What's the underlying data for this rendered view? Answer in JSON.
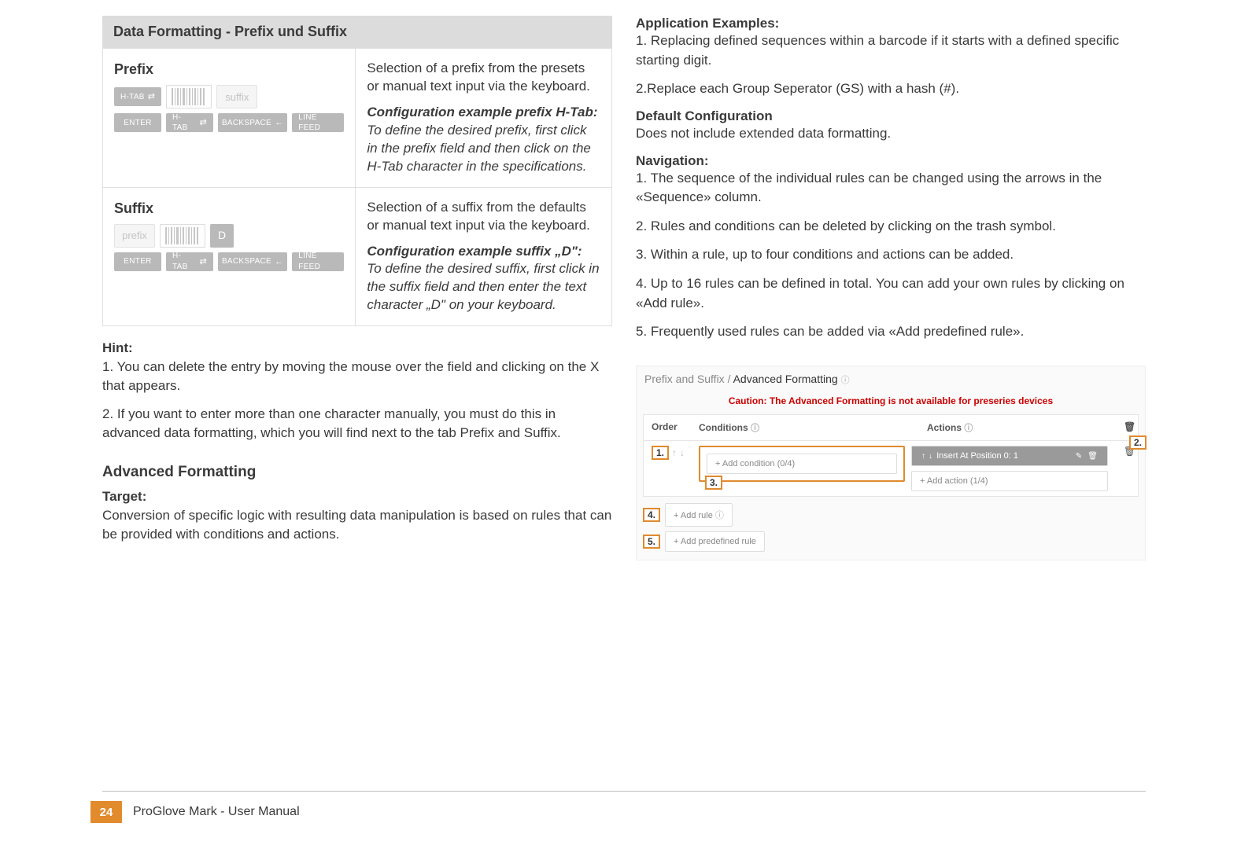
{
  "left": {
    "section_title": "Data Formatting - Prefix und Suffix",
    "prefix": {
      "title": "Prefix",
      "desc": "Selection of a prefix from the presets or manual text input via the keyboard.",
      "ex_h": "Configuration example prefix H-Tab:",
      "ex_b": "To define the desired prefix, first click in the prefix field and then click on the H-Tab character in the specifications.",
      "suffix_ghost": "suffix"
    },
    "suffix": {
      "title": "Suffix",
      "desc": "Selection of a suffix from the defaults or manual text input via the keyboard.",
      "ex_h": "Configuration example suffix „D\":",
      "ex_b": "To define the desired suffix, first click in the suffix field and then enter the text character „D\" on your keyboard.",
      "prefix_ghost": "prefix",
      "d_label": "D"
    },
    "chips": {
      "htab": "H-TAB",
      "enter": "ENTER",
      "backspace": "BACKSPACE",
      "linefeed": "LINE FEED"
    },
    "hint_h": "Hint:",
    "hint_1": "1. You can delete the entry by moving the mouse over the field and clicking on the X that appears.",
    "hint_2": "2. If you want to enter more than one character manually, you must do this in advanced data formatting, which you will find next to the tab Prefix and Suffix.",
    "adv_h": "Advanced Formatting",
    "target_h": "Target:",
    "target_p": "Conversion of specific logic with resulting data manipulation is based on rules that can be provided with conditions and actions."
  },
  "right": {
    "app_h": "Application Examples:",
    "app_1": "1. Replacing defined sequences within a barcode if it starts with a defined specific starting digit.",
    "app_2": "2.Replace each Group Seperator (GS) with a hash (#).",
    "def_h": "Default Configuration",
    "def_p": "Does not include extended data formatting.",
    "nav_h": "Navigation:",
    "nav_1": "1. The sequence of the individual rules can be changed using the arrows in the «Sequence» column.",
    "nav_2": "2. Rules and conditions can be deleted by clicking on the trash symbol.",
    "nav_3": "3. Within a rule, up to four conditions and actions can be added.",
    "nav_4": "4. Up to 16 rules can be defined in total. You can add your own rules by clicking on «Add rule».",
    "nav_5": "5. Frequently used rules can be added via «Add predefined rule»."
  },
  "af": {
    "crumb_prev": "Prefix and Suffix",
    "crumb_sep": "/",
    "crumb_cur": "Advanced Formatting",
    "warn": "Caution: The Advanced Formatting is not available for preseries devices",
    "th_order": "Order",
    "th_cond": "Conditions",
    "th_act": "Actions",
    "order_val": "1.",
    "add_cond": "+ Add condition (0/4)",
    "insert_act": "Insert At Position 0:  1",
    "add_act": "+ Add action (1/4)",
    "add_rule": "+ Add rule",
    "add_pre": "+ Add predefined rule",
    "m1": "1.",
    "m2": "2.",
    "m3": "3.",
    "m4": "4.",
    "m5": "5."
  },
  "footer": {
    "page": "24",
    "title": "ProGlove Mark - User Manual"
  }
}
